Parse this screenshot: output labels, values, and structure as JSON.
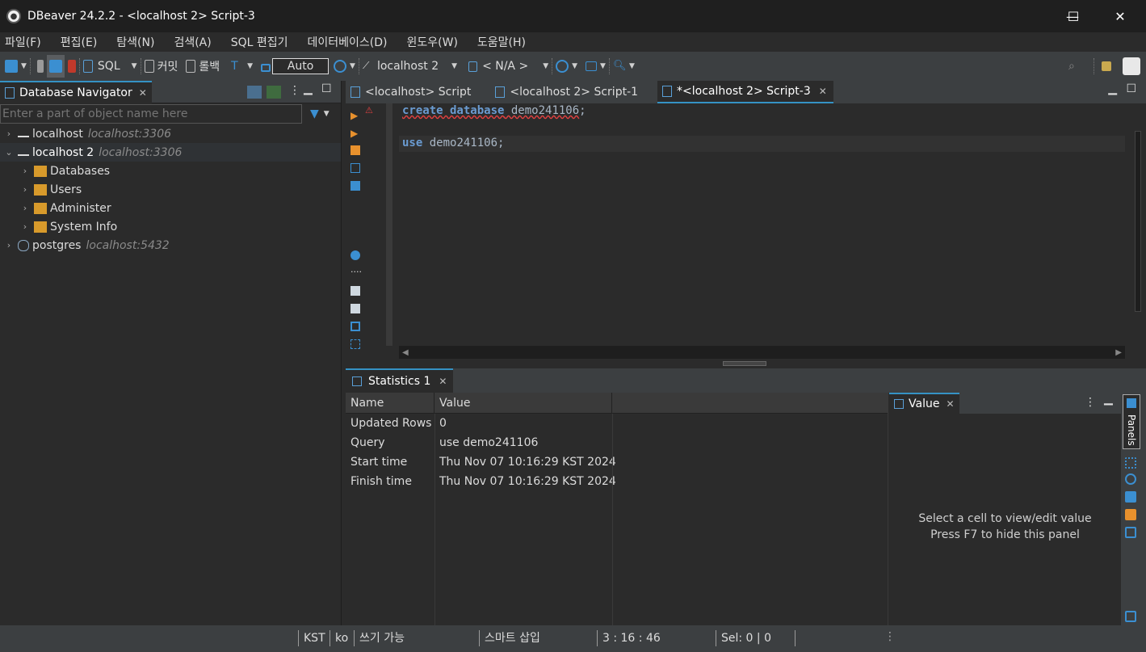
{
  "window": {
    "title": "DBeaver 24.2.2 - <localhost 2> Script-3",
    "controls": {
      "minimize": "—",
      "maximize": "☐",
      "close": "✕"
    }
  },
  "menu": [
    "파일(F)",
    "편집(E)",
    "탐색(N)",
    "검색(A)",
    "SQL 편집기",
    "데이터베이스(D)",
    "윈도우(W)",
    "도움말(H)"
  ],
  "toolbar": {
    "sql_label": "SQL",
    "commit_label": "커밋",
    "rollback_label": "롤백",
    "transaction_mode": "Auto",
    "datasource_label": "localhost 2",
    "schema_label": "< N/A >"
  },
  "navigator": {
    "tab_label": "Database Navigator",
    "filter_placeholder": "Enter a part of object name here",
    "tree": [
      {
        "label": "localhost",
        "sub": "localhost:3306",
        "expanded": false,
        "selected": false
      },
      {
        "label": "localhost 2",
        "sub": "localhost:3306",
        "expanded": true,
        "selected": true,
        "children": [
          "Databases",
          "Users",
          "Administer",
          "System Info"
        ]
      },
      {
        "label": "postgres",
        "sub": "localhost:5432",
        "expanded": false,
        "selected": false
      }
    ]
  },
  "editor": {
    "tabs": [
      {
        "label": "<localhost> Script",
        "active": false
      },
      {
        "label": "<localhost 2> Script-1",
        "active": false
      },
      {
        "label": "*<localhost 2> Script-3",
        "active": true
      }
    ],
    "lines": [
      {
        "keyword": "create database",
        "rest": " demo241106",
        "end": ";"
      },
      {
        "keyword": "",
        "rest": "",
        "end": ""
      },
      {
        "keyword": "use",
        "rest": " demo241106",
        "end": ";"
      }
    ]
  },
  "results": {
    "tab_label": "Statistics 1",
    "columns": [
      "Name",
      "Value"
    ],
    "rows": [
      {
        "name": "Updated Rows",
        "value": "0"
      },
      {
        "name": "Query",
        "value": "use demo241106"
      },
      {
        "name": "Start time",
        "value": "Thu Nov 07 10:16:29 KST 2024"
      },
      {
        "name": "Finish time",
        "value": "Thu Nov 07 10:16:29 KST 2024"
      }
    ]
  },
  "value_panel": {
    "tab_label": "Value",
    "message_line1": "Select a cell to view/edit value",
    "message_line2": "Press F7 to hide this panel",
    "side_label": "Panels"
  },
  "status": {
    "timezone": "KST",
    "locale": "ko",
    "write_mode": "쓰기 가능",
    "insert_mode": "스마트 삽입",
    "position": "3 : 16 : 46",
    "selection": "Sel: 0 | 0"
  },
  "colors": {
    "accent": "#3592c4",
    "keyword": "#6a9bd1",
    "background": "#2b2b2b",
    "chrome": "#3c3f41"
  }
}
